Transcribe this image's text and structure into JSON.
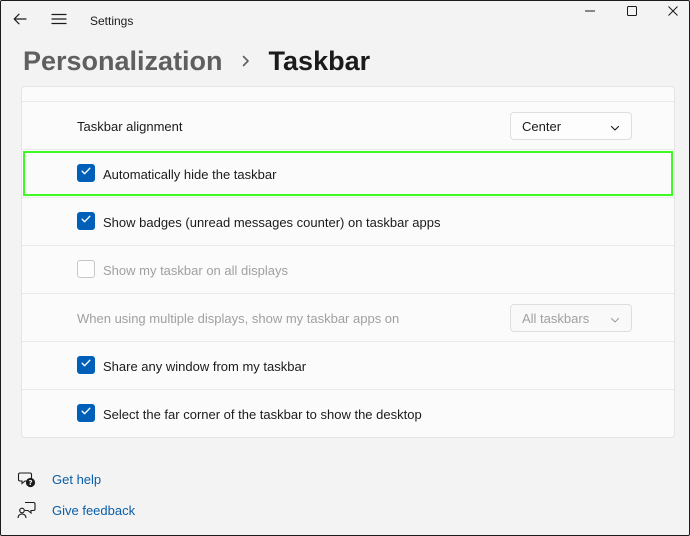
{
  "window": {
    "app_title": "Settings",
    "back_icon": "back-arrow-icon",
    "menu_icon": "hamburger-menu-icon",
    "minimize_icon": "minimize-icon",
    "maximize_icon": "maximize-icon",
    "close_icon": "close-icon"
  },
  "breadcrumb": {
    "parent": "Personalization",
    "separator_icon": "chevron-right-icon",
    "current": "Taskbar"
  },
  "settings": {
    "alignment": {
      "label": "Taskbar alignment",
      "value": "Center"
    },
    "auto_hide": {
      "label": "Automatically hide the taskbar",
      "checked": true
    },
    "badges": {
      "label": "Show badges (unread messages counter) on taskbar apps",
      "checked": true
    },
    "all_displays": {
      "label": "Show my taskbar on all displays",
      "checked": false,
      "disabled": true
    },
    "multi_display": {
      "label": "When using multiple displays, show my taskbar apps on",
      "value": "All taskbars",
      "disabled": true
    },
    "share_window": {
      "label": "Share any window from my taskbar",
      "checked": true
    },
    "far_corner": {
      "label": "Select the far corner of the taskbar to show the desktop",
      "checked": true
    }
  },
  "footer": {
    "help": {
      "label": "Get help",
      "icon": "help-icon"
    },
    "feedback": {
      "label": "Give feedback",
      "icon": "feedback-icon"
    }
  },
  "colors": {
    "accent": "#005fb8",
    "highlight_box": "#3cfa22",
    "link": "#0a5ea8"
  }
}
